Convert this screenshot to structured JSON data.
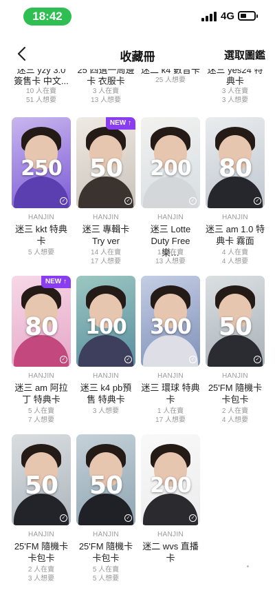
{
  "status_bar": {
    "time": "18:42",
    "network": "4G",
    "battery_level": 0.45
  },
  "nav": {
    "title": "收藏冊",
    "action": "選取圖鑑"
  },
  "partial_row": [
    {
      "name": "迷三 yzy 3.0 簽售卡 中文...",
      "stats": [
        "10 人在賣",
        "51 人想要"
      ]
    },
    {
      "name": "25 四選一周邊卡 衣服卡",
      "stats": [
        "3 人在賣",
        "13 人想要"
      ]
    },
    {
      "name": "迷二 k4 數音卡",
      "stats": [
        "25 人想要"
      ]
    },
    {
      "name": "迷三 yes24 特典卡",
      "stats": [
        "3 人在賣",
        "3 人想要"
      ]
    }
  ],
  "check_icon": "✓",
  "new_badge_label": "NEW ↑",
  "cards": [
    {
      "price": "250",
      "brand": "HANJIN",
      "name": "迷三 kkt 特典卡",
      "stats": [
        "5 人想要"
      ],
      "is_new": false,
      "bg": "#7c5bd6",
      "bg2": "#c9b6ee",
      "shirt": "#5b3fb0"
    },
    {
      "price": "50",
      "brand": "HANJIN",
      "name": "迷三 專輯卡 Try ver",
      "stats": [
        "14 人在賣",
        "17 人想要"
      ],
      "is_new": true,
      "bg": "#c9c2b9",
      "bg2": "#efeae3",
      "shirt": "#3a3330"
    },
    {
      "price": "200",
      "brand": "HANJIN",
      "name": "迷三 Lotte Duty Free 樂…",
      "stats": [
        "1 人在賣",
        "13 人想要"
      ],
      "is_new": false,
      "bg": "#d6dee2",
      "bg2": "#f2f2f0",
      "shirt": "#d4d7da"
    },
    {
      "price": "80",
      "brand": "HANJIN",
      "name": "迷三 am 1.0 特典卡 霧面",
      "stats": [
        "4 人在賣",
        "4 人想要"
      ],
      "is_new": false,
      "bg": "#c0c7cf",
      "bg2": "#e9ecef",
      "shirt": "#26272c"
    },
    {
      "price": "80",
      "brand": "HANJIN",
      "name": "迷三 am 阿拉丁 特典卡",
      "stats": [
        "5 人在賣",
        "7 人想要"
      ],
      "is_new": true,
      "bg": "#e6a7c7",
      "bg2": "#f6d8e7",
      "shirt": "#c2487e"
    },
    {
      "price": "100",
      "brand": "HANJIN",
      "name": "迷三 k4 pb預售 特典卡",
      "stats": [
        "3 人想要"
      ],
      "is_new": false,
      "bg": "#5a8fa0",
      "bg2": "#9cc7c1",
      "shirt": "#3d3f5c"
    },
    {
      "price": "300",
      "brand": "HANJIN",
      "name": "迷三 環球 特典卡",
      "stats": [
        "1 人在賣",
        "17 人想要"
      ],
      "is_new": false,
      "bg": "#7f90b8",
      "bg2": "#c4cde4",
      "shirt": "#dedfe6"
    },
    {
      "price": "50",
      "brand": "HANJIN",
      "name": "25'FM 隨機卡 卡包卡",
      "stats": [
        "2 人在賣",
        "4 人想要"
      ],
      "is_new": false,
      "bg": "#a9b2b8",
      "bg2": "#dadfe2",
      "shirt": "#2a2c31"
    },
    {
      "price": "50",
      "brand": "HANJIN",
      "name": "25'FM 隨機卡 卡包卡",
      "stats": [
        "2 人在賣",
        "3 人想要"
      ],
      "is_new": false,
      "bg": "#adb6bd",
      "bg2": "#d9dde0",
      "shirt": "#23242a"
    },
    {
      "price": "50",
      "brand": "HANJIN",
      "name": "25'FM 隨機卡 卡包卡",
      "stats": [
        "5 人在賣",
        "5 人想要"
      ],
      "is_new": false,
      "bg": "#8fa5b3",
      "bg2": "#c5d1d8",
      "shirt": "#1f2127"
    },
    {
      "price": "200",
      "brand": "HANJIN",
      "name": "迷二 wvs 直播卡",
      "stats": [],
      "is_new": false,
      "bg": "#ececec",
      "bg2": "#f9f9f9",
      "shirt": "#2b2b2f"
    }
  ]
}
